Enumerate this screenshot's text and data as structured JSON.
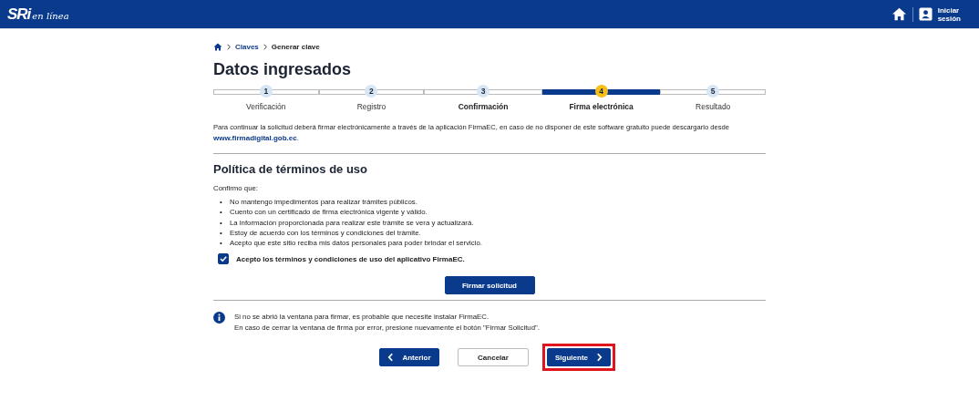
{
  "header": {
    "logo": "SRi",
    "logo_script": "en línea",
    "login": [
      "Iniciar",
      "sesión"
    ]
  },
  "breadcrumb": [
    "Claves",
    "Generar clave"
  ],
  "title": "Datos ingresados",
  "steps": [
    {
      "number": "1",
      "label": "Verificación",
      "selected": false,
      "bold": false
    },
    {
      "number": "2",
      "label": "Registro",
      "selected": false,
      "bold": false
    },
    {
      "number": "3",
      "label": "Confirmación",
      "selected": false,
      "bold": true
    },
    {
      "number": "4",
      "label": "Firma electrónica",
      "selected": true,
      "bold": true
    },
    {
      "number": "5",
      "label": "Resultado",
      "selected": false,
      "bold": false
    }
  ],
  "intro": "Para continuar la solicitud deberá firmar electrónicamente a través de la aplicación FirmaEC, en caso de no disponer de este software gratuito puede descargarlo desde",
  "intro_link": "www.firmadigital.gob.ec",
  "intro_end": ".",
  "policy": {
    "heading": "Política de términos de uso",
    "lead": "Confirmo que:",
    "bullet": "•",
    "items": [
      "No mantengo impedimentos para realizar trámites públicos.",
      "Cuento con un certificado de firma electrónica vigente y válido.",
      "La información proporcionada para realizar este trámite se vera y actualizará.",
      "Estoy de acuerdo con los términos y condiciones del trámite.",
      "Acepto que este sitio reciba mis datos personales para poder brindar el servicio."
    ],
    "accept": {
      "label": "Acepto los términos y condiciones de uso del aplicativo FirmaEC.",
      "checked": true
    },
    "sign_button": "Firmar solicitud"
  },
  "info": [
    "Si no se abrió la ventana para firmar, es probable que necesite instalar FirmaEC.",
    "En caso de cerrar la ventana de firma por error, presione nuevamente el botón \"Firmar Solicitud\"."
  ],
  "buttons": [
    {
      "kind": "back",
      "label": "Anterior",
      "highlighted": false
    },
    {
      "kind": "cancel",
      "label": "Cancelar",
      "highlighted": false
    },
    {
      "kind": "next",
      "label": "Siguiente",
      "highlighted": true
    }
  ]
}
